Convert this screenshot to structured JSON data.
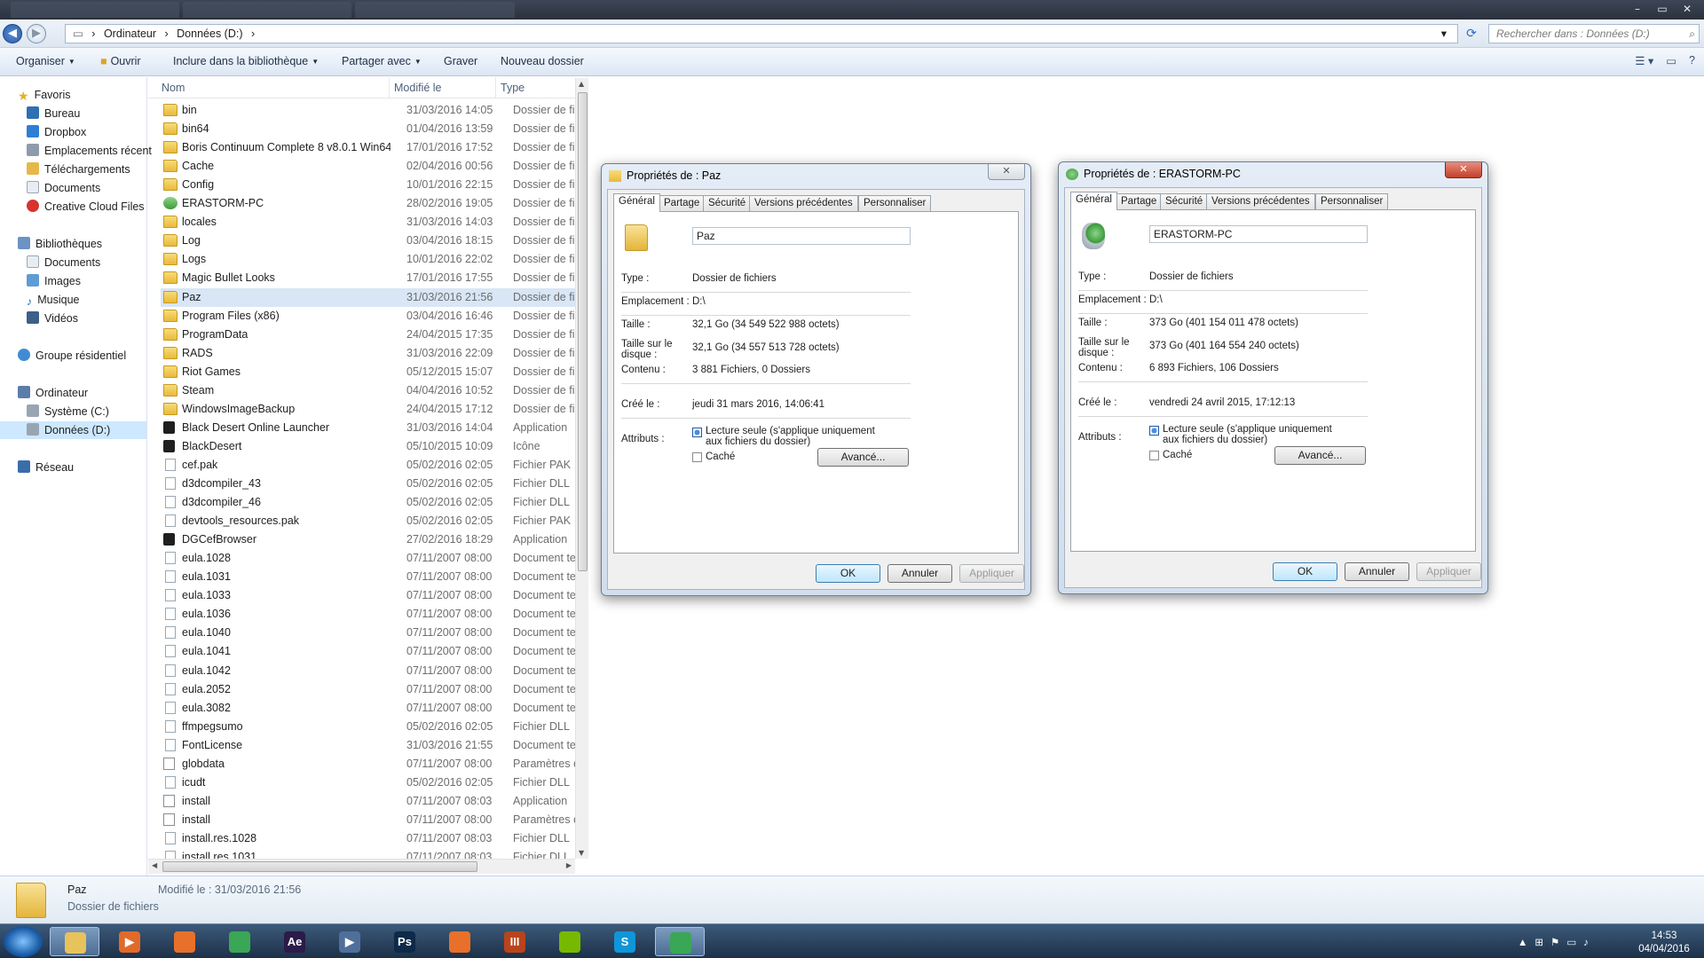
{
  "explorer": {
    "breadcrumb": [
      "Ordinateur",
      "Données (D:)"
    ],
    "search_placeholder": "Rechercher dans : Données (D:)",
    "toolbar": {
      "organiser": "Organiser",
      "ouvrir": "Ouvrir",
      "inclure": "Inclure dans la bibliothèque",
      "partager": "Partager avec",
      "graver": "Graver",
      "nouveau_dossier": "Nouveau dossier"
    },
    "nav": {
      "favoris": "Favoris",
      "bureau": "Bureau",
      "dropbox": "Dropbox",
      "emplacements": "Emplacements récent",
      "telechargements": "Téléchargements",
      "documents": "Documents",
      "creative_cloud": "Creative Cloud Files",
      "bibliotheques": "Bibliothèques",
      "lib_documents": "Documents",
      "images": "Images",
      "musique": "Musique",
      "videos": "Vidéos",
      "groupe": "Groupe résidentiel",
      "ordinateur": "Ordinateur",
      "systeme": "Système (C:)",
      "donnees": "Données (D:)",
      "reseau": "Réseau"
    },
    "columns": {
      "nom": "Nom",
      "modifie": "Modifié le",
      "type": "Type"
    },
    "files": [
      {
        "name": "bin",
        "date": "31/03/2016 14:05",
        "type": "Dossier de fichie",
        "icon": "folder"
      },
      {
        "name": "bin64",
        "date": "01/04/2016 13:59",
        "type": "Dossier de fichie",
        "icon": "folder"
      },
      {
        "name": "Boris Continuum Complete 8 v8.0.1 Win64",
        "date": "17/01/2016 17:52",
        "type": "Dossier de fichie",
        "icon": "folder"
      },
      {
        "name": "Cache",
        "date": "02/04/2016 00:56",
        "type": "Dossier de fichie",
        "icon": "folder"
      },
      {
        "name": "Config",
        "date": "10/01/2016 22:15",
        "type": "Dossier de fichie",
        "icon": "folder"
      },
      {
        "name": "ERASTORM-PC",
        "date": "28/02/2016 19:05",
        "type": "Dossier de fichie",
        "icon": "pc"
      },
      {
        "name": "locales",
        "date": "31/03/2016 14:03",
        "type": "Dossier de fichie",
        "icon": "folder"
      },
      {
        "name": "Log",
        "date": "03/04/2016 18:15",
        "type": "Dossier de fichie",
        "icon": "folder"
      },
      {
        "name": "Logs",
        "date": "10/01/2016 22:02",
        "type": "Dossier de fichie",
        "icon": "folder"
      },
      {
        "name": "Magic Bullet Looks",
        "date": "17/01/2016 17:55",
        "type": "Dossier de fichie",
        "icon": "folder"
      },
      {
        "name": "Paz",
        "date": "31/03/2016 21:56",
        "type": "Dossier de fichie",
        "icon": "folder",
        "selected": true
      },
      {
        "name": "Program Files (x86)",
        "date": "03/04/2016 16:46",
        "type": "Dossier de fichie",
        "icon": "folder"
      },
      {
        "name": "ProgramData",
        "date": "24/04/2015 17:35",
        "type": "Dossier de fichie",
        "icon": "folder"
      },
      {
        "name": "RADS",
        "date": "31/03/2016 22:09",
        "type": "Dossier de fichie",
        "icon": "folder"
      },
      {
        "name": "Riot Games",
        "date": "05/12/2015 15:07",
        "type": "Dossier de fichie",
        "icon": "folder"
      },
      {
        "name": "Steam",
        "date": "04/04/2016 10:52",
        "type": "Dossier de fichie",
        "icon": "folder"
      },
      {
        "name": "WindowsImageBackup",
        "date": "24/04/2015 17:12",
        "type": "Dossier de fichie",
        "icon": "folder"
      },
      {
        "name": "Black Desert Online Launcher",
        "date": "31/03/2016 14:04",
        "type": "Application",
        "icon": "app"
      },
      {
        "name": "BlackDesert",
        "date": "05/10/2015 10:09",
        "type": "Icône",
        "icon": "app"
      },
      {
        "name": "cef.pak",
        "date": "05/02/2016 02:05",
        "type": "Fichier PAK",
        "icon": "file"
      },
      {
        "name": "d3dcompiler_43",
        "date": "05/02/2016 02:05",
        "type": "Fichier DLL",
        "icon": "file"
      },
      {
        "name": "d3dcompiler_46",
        "date": "05/02/2016 02:05",
        "type": "Fichier DLL",
        "icon": "file"
      },
      {
        "name": "devtools_resources.pak",
        "date": "05/02/2016 02:05",
        "type": "Fichier PAK",
        "icon": "file"
      },
      {
        "name": "DGCefBrowser",
        "date": "27/02/2016 18:29",
        "type": "Application",
        "icon": "app"
      },
      {
        "name": "eula.1028",
        "date": "07/11/2007 08:00",
        "type": "Document texte",
        "icon": "file"
      },
      {
        "name": "eula.1031",
        "date": "07/11/2007 08:00",
        "type": "Document texte",
        "icon": "file"
      },
      {
        "name": "eula.1033",
        "date": "07/11/2007 08:00",
        "type": "Document texte",
        "icon": "file"
      },
      {
        "name": "eula.1036",
        "date": "07/11/2007 08:00",
        "type": "Document texte",
        "icon": "file"
      },
      {
        "name": "eula.1040",
        "date": "07/11/2007 08:00",
        "type": "Document texte",
        "icon": "file"
      },
      {
        "name": "eula.1041",
        "date": "07/11/2007 08:00",
        "type": "Document texte",
        "icon": "file"
      },
      {
        "name": "eula.1042",
        "date": "07/11/2007 08:00",
        "type": "Document texte",
        "icon": "file"
      },
      {
        "name": "eula.2052",
        "date": "07/11/2007 08:00",
        "type": "Document texte",
        "icon": "file"
      },
      {
        "name": "eula.3082",
        "date": "07/11/2007 08:00",
        "type": "Document texte",
        "icon": "file"
      },
      {
        "name": "ffmpegsumo",
        "date": "05/02/2016 02:05",
        "type": "Fichier DLL",
        "icon": "file"
      },
      {
        "name": "FontLicense",
        "date": "31/03/2016 21:55",
        "type": "Document texte",
        "icon": "file"
      },
      {
        "name": "globdata",
        "date": "07/11/2007 08:00",
        "type": "Paramètres de c",
        "icon": "cfg"
      },
      {
        "name": "icudt",
        "date": "05/02/2016 02:05",
        "type": "Fichier DLL",
        "icon": "file"
      },
      {
        "name": "install",
        "date": "07/11/2007 08:03",
        "type": "Application",
        "icon": "cfg"
      },
      {
        "name": "install",
        "date": "07/11/2007 08:00",
        "type": "Paramètres de c",
        "icon": "cfg"
      },
      {
        "name": "install.res.1028",
        "date": "07/11/2007 08:03",
        "type": "Fichier DLL",
        "icon": "file"
      },
      {
        "name": "install.res.1031",
        "date": "07/11/2007 08:03",
        "type": "Fichier DLL",
        "icon": "file"
      }
    ],
    "details": {
      "name": "Paz",
      "type": "Dossier de fichiers",
      "modified": "Modifié le : 31/03/2016 21:56"
    }
  },
  "dialog_paz": {
    "title": "Propriétés de : Paz",
    "tabs": [
      "Général",
      "Partage",
      "Sécurité",
      "Versions précédentes",
      "Personnaliser"
    ],
    "name": "Paz",
    "labels": {
      "type": "Type :",
      "emplacement": "Emplacement :",
      "taille": "Taille :",
      "taille_disque": "Taille sur le disque :",
      "contenu": "Contenu :",
      "cree": "Créé le :",
      "attributs": "Attributs :"
    },
    "type": "Dossier de fichiers",
    "emplacement": "D:\\",
    "taille": "32,1 Go (34 549 522 988 octets)",
    "taille_disque": "32,1 Go (34 557 513 728 octets)",
    "contenu": "3 881 Fichiers, 0 Dossiers",
    "cree": "jeudi 31 mars 2016, 14:06:41",
    "lecture_seule": "Lecture seule (s'applique uniquement aux fichiers du dossier)",
    "cache": "Caché",
    "avance": "Avancé...",
    "ok": "OK",
    "annuler": "Annuler",
    "appliquer": "Appliquer"
  },
  "dialog_pc": {
    "title": "Propriétés de : ERASTORM-PC",
    "tabs": [
      "Général",
      "Partage",
      "Sécurité",
      "Versions précédentes",
      "Personnaliser"
    ],
    "name": "ERASTORM-PC",
    "labels": {
      "type": "Type :",
      "emplacement": "Emplacement :",
      "taille": "Taille :",
      "taille_disque": "Taille sur le disque :",
      "contenu": "Contenu :",
      "cree": "Créé le :",
      "attributs": "Attributs :"
    },
    "type": "Dossier de fichiers",
    "emplacement": "D:\\",
    "taille": "373 Go (401 154 011 478 octets)",
    "taille_disque": "373 Go (401 164 554 240 octets)",
    "contenu": "6 893 Fichiers, 106 Dossiers",
    "cree": "vendredi 24 avril 2015, 17:12:13",
    "lecture_seule": "Lecture seule (s'applique uniquement aux fichiers du dossier)",
    "cache": "Caché",
    "avance": "Avancé...",
    "ok": "OK",
    "annuler": "Annuler",
    "appliquer": "Appliquer"
  },
  "taskbar": {
    "apps": [
      {
        "icon": "explorer-icon",
        "glyph": "",
        "color": "#e8c25a",
        "active": true
      },
      {
        "icon": "media-player-icon",
        "glyph": "▶",
        "color": "#e06a2a"
      },
      {
        "icon": "firefox-icon",
        "glyph": "",
        "color": "#e8702a"
      },
      {
        "icon": "chrome-icon",
        "glyph": "",
        "color": "#3aa757"
      },
      {
        "icon": "after-effects-icon",
        "glyph": "Ae",
        "color": "#2b1a4a"
      },
      {
        "icon": "video-player-icon",
        "glyph": "▶",
        "color": "#4f6f9a"
      },
      {
        "icon": "photoshop-icon",
        "glyph": "Ps",
        "color": "#0c2a4a"
      },
      {
        "icon": "firefox-icon",
        "glyph": "",
        "color": "#e8702a"
      },
      {
        "icon": "game-icon",
        "glyph": "III",
        "color": "#b8441c"
      },
      {
        "icon": "nvidia-icon",
        "glyph": "",
        "color": "#76b900"
      },
      {
        "icon": "skype-icon",
        "glyph": "S",
        "color": "#0f96d8"
      },
      {
        "icon": "chrome-icon",
        "glyph": "",
        "color": "#3aa757",
        "active": true
      }
    ],
    "time": "14:53",
    "date": "04/04/2016"
  }
}
